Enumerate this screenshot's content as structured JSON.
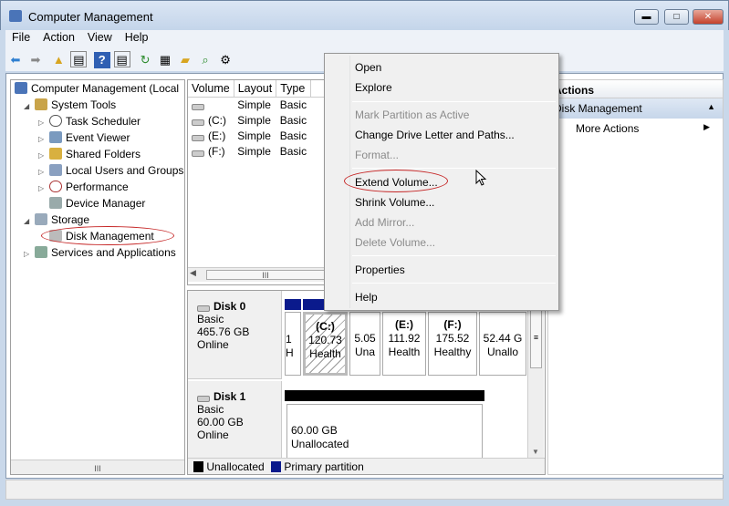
{
  "window": {
    "title": "Computer Management",
    "buttons": {
      "minimize": "▬",
      "maximize": "□",
      "close": "✕"
    }
  },
  "menubar": [
    "File",
    "Action",
    "View",
    "Help"
  ],
  "toolbar": [
    "back-icon",
    "forward-icon",
    "up-icon",
    "show-hide-tree-icon",
    "help-icon",
    "show-hide-action-icon",
    "refresh-icon",
    "properties-icon",
    "open-icon",
    "search-icon",
    "settings-icon"
  ],
  "tree": {
    "root": "Computer Management (Local",
    "system_tools": "System Tools",
    "items": [
      "Task Scheduler",
      "Event Viewer",
      "Shared Folders",
      "Local Users and Groups",
      "Performance",
      "Device Manager"
    ],
    "storage": "Storage",
    "disk_management": "Disk Management",
    "services": "Services and Applications"
  },
  "volumes": {
    "headers": [
      "Volume",
      "Layout",
      "Type"
    ],
    "rows": [
      [
        "",
        "Simple",
        "Basic"
      ],
      [
        "(C:)",
        "Simple",
        "Basic"
      ],
      [
        "(E:)",
        "Simple",
        "Basic"
      ],
      [
        "(F:)",
        "Simple",
        "Basic"
      ]
    ]
  },
  "disks": [
    {
      "name": "Disk 0",
      "type": "Basic",
      "size": "465.76 GB",
      "status": "Online",
      "partitions": [
        {
          "label": "",
          "size": "1",
          "status": "H",
          "kind": "primary"
        },
        {
          "label": "(C:)",
          "size": "120.73",
          "status": "Health",
          "kind": "primary"
        },
        {
          "label": "",
          "size": "5.05",
          "status": "Una",
          "kind": "unallocated"
        },
        {
          "label": "(E:)",
          "size": "111.92",
          "status": "Health",
          "kind": "primary"
        },
        {
          "label": "(F:)",
          "size": "175.52",
          "status": "Healthy",
          "kind": "primary"
        },
        {
          "label": "",
          "size": "52.44 G",
          "status": "Unallo",
          "kind": "unallocated"
        }
      ]
    },
    {
      "name": "Disk 1",
      "type": "Basic",
      "size": "60.00 GB",
      "status": "Online",
      "partitions": [
        {
          "size": "60.00 GB",
          "status": "Unallocated",
          "kind": "unallocated"
        }
      ]
    }
  ],
  "legend": {
    "unallocated": "Unallocated",
    "primary": "Primary partition"
  },
  "colors": {
    "unallocated": "#000000",
    "primary": "#0a1a8c",
    "highlight": "#c62828"
  },
  "actions": {
    "header": "Actions",
    "section": "Disk Management",
    "more": "More Actions"
  },
  "context_menu": {
    "open": "Open",
    "explore": "Explore",
    "mark_active": "Mark Partition as Active",
    "change_letter": "Change Drive Letter and Paths...",
    "format": "Format...",
    "extend": "Extend Volume...",
    "shrink": "Shrink Volume...",
    "add_mirror": "Add Mirror...",
    "delete": "Delete Volume...",
    "properties": "Properties",
    "help": "Help"
  },
  "scroll": {
    "thumb": "III"
  }
}
